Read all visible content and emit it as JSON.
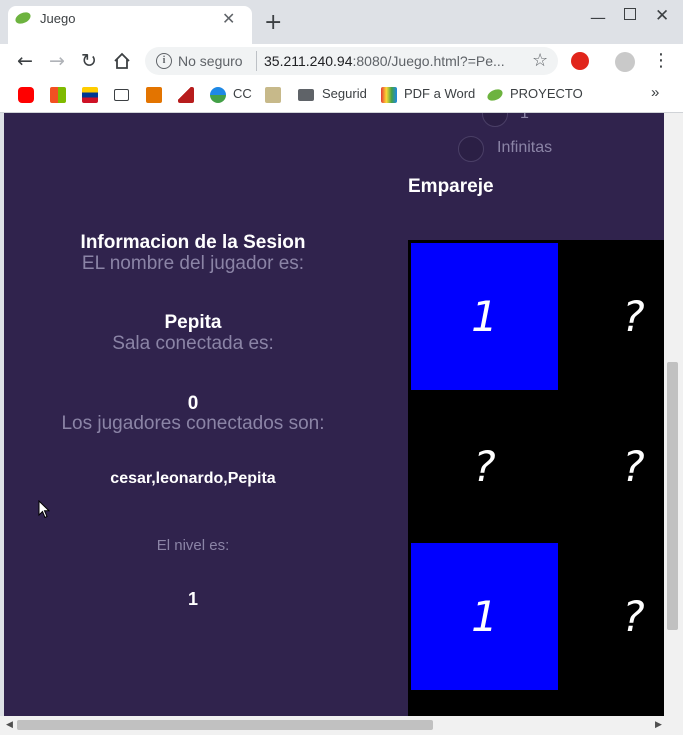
{
  "browser": {
    "tab_title": "Juego",
    "new_tab": "+",
    "close_tab": "✕",
    "window_min": "—",
    "window_close": "✕",
    "not_secure": "No seguro",
    "url_host": "35.211.240.94",
    "url_rest": ":8080/Juego.html?=Pe...",
    "bookmarks": {
      "cc": "CC",
      "seguridad": "Segurid",
      "pdf_word": "PDF a Word",
      "proyecto": "PROYECTO",
      "more": "»"
    }
  },
  "page": {
    "radio_options": [
      "1",
      "Infinitas"
    ],
    "match_heading": "Empareje",
    "session_title": "Informacion de la Sesion",
    "player_label": "EL nombre del jugador es:",
    "player_name": "Pepita",
    "room_label": "Sala conectada es:",
    "room_value": "0",
    "players_label": "Los jugadores conectados son:",
    "players_value": "cesar,leonardo,Pepita",
    "level_label": "El nivel es:",
    "level_value": "1",
    "board": [
      [
        "1",
        "?"
      ],
      [
        "?",
        "?"
      ],
      [
        "1",
        "?"
      ]
    ],
    "board_revealed": [
      [
        true,
        false
      ],
      [
        false,
        false
      ],
      [
        true,
        false
      ]
    ]
  },
  "colors": {
    "page_bg": "#30234d",
    "card_revealed": "#0000ff",
    "card_hidden": "#000000"
  }
}
